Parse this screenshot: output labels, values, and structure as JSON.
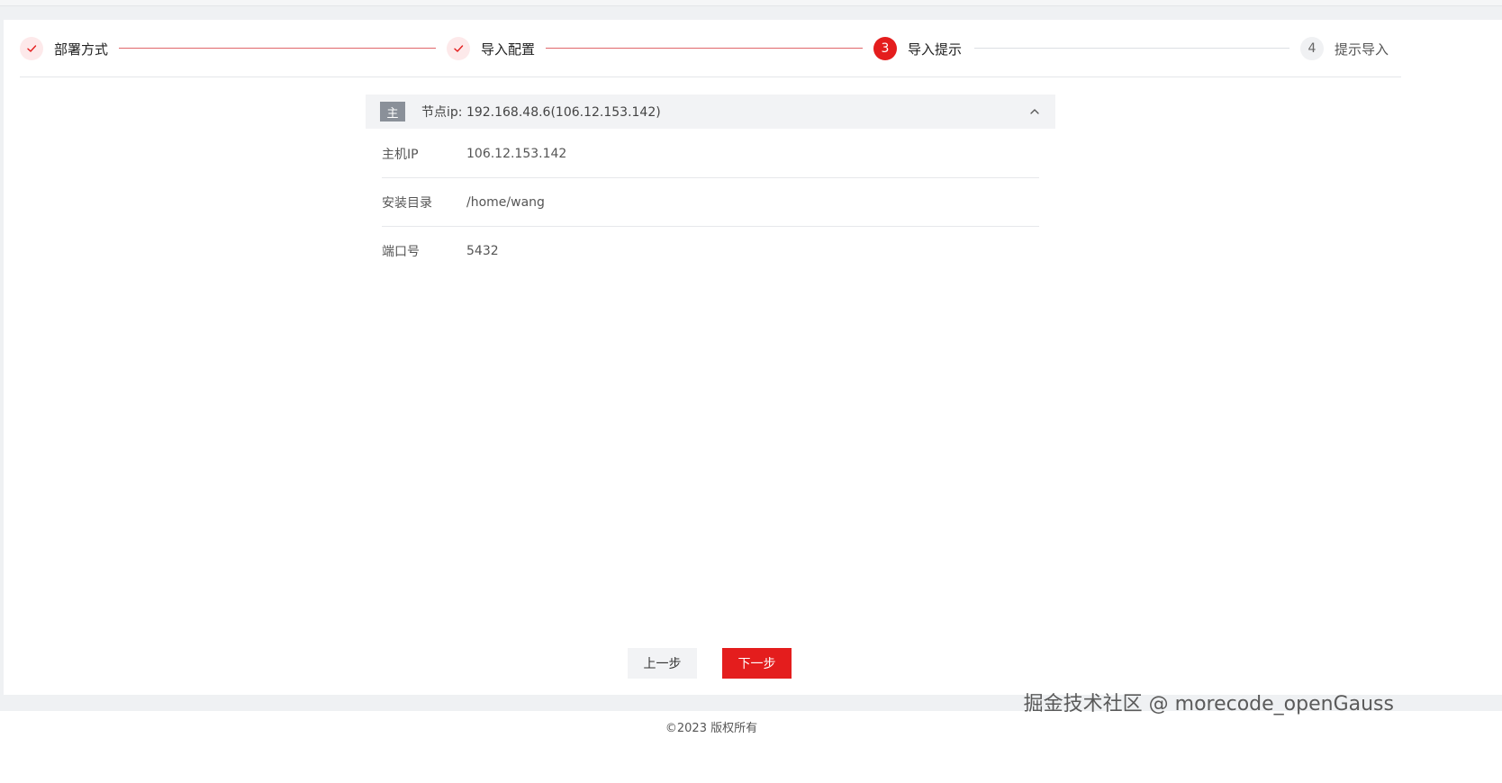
{
  "steps": [
    {
      "label": "部署方式",
      "state": "done",
      "icon": "check-icon"
    },
    {
      "label": "导入配置",
      "state": "done",
      "icon": "check-icon"
    },
    {
      "label": "导入提示",
      "state": "active",
      "number": "3"
    },
    {
      "label": "提示导入",
      "state": "pending",
      "number": "4"
    }
  ],
  "node": {
    "badge": "主",
    "title": "节点ip: 192.168.48.6(106.12.153.142)",
    "rows": [
      {
        "label": "主机IP",
        "value": "106.12.153.142"
      },
      {
        "label": "安装目录",
        "value": "/home/wang"
      },
      {
        "label": "端口号",
        "value": "5432"
      }
    ]
  },
  "buttons": {
    "prev": "上一步",
    "next": "下一步"
  },
  "footer": {
    "copyright": "©2023 版权所有"
  },
  "watermark": "掘金技术社区 @ morecode_openGauss",
  "colors": {
    "accent": "#e41d1d",
    "done_bg": "#fde9ea",
    "connector_done": "#e0666a"
  }
}
